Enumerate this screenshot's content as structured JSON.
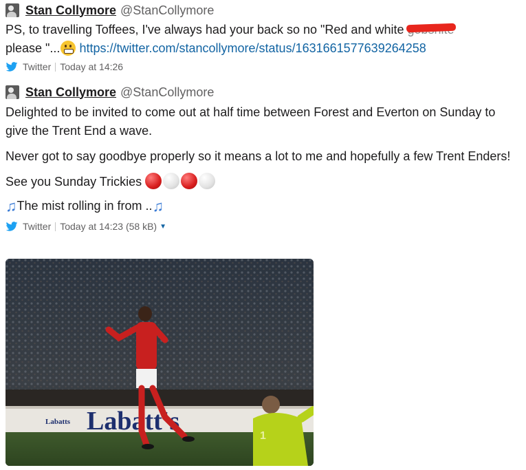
{
  "tweets": [
    {
      "author_name": "Stan Collymore",
      "author_handle": "@StanCollymore",
      "text_part1": "PS, to travelling Toffees, I've always had your back so no \"Red and white ",
      "text_struck": "gobshite",
      "text_part2": "please \"...",
      "link": "https://twitter.com/stancollymore/status/1631661577639264258",
      "source": "Twitter",
      "timestamp": "Today at 14:26"
    },
    {
      "author_name": "Stan Collymore",
      "author_handle": "@StanCollymore",
      "para1": "Delighted to be invited to come out at half time between Forest and Everton on Sunday to give the Trent End a wave.",
      "para2": "Never got to say goodbye properly so it means a lot to me and hopefully a few Trent Enders!",
      "para3": "See you Sunday Trickies ",
      "para4": "The mist rolling in from ..",
      "source": "Twitter",
      "timestamp": "Today at 14:23 (58 kB)",
      "image_board_text": "Labatt's",
      "image_small_board_text": "Labatts",
      "image_keeper_number": "1"
    }
  ],
  "colors": {
    "link": "#1264a3",
    "twitter_blue": "#1da1f2",
    "meta": "#616061"
  }
}
